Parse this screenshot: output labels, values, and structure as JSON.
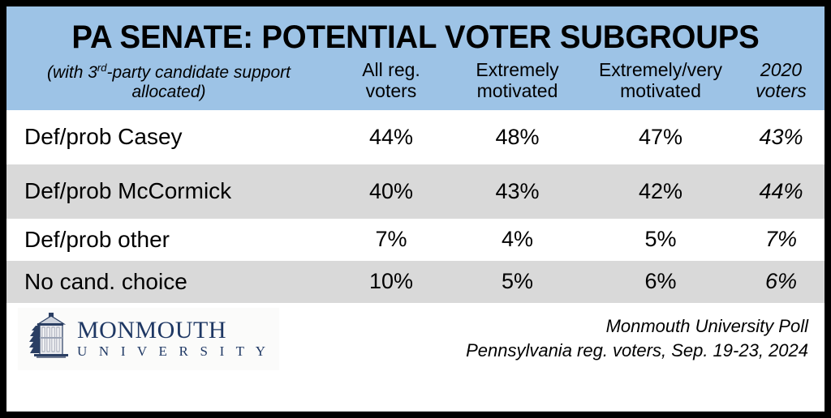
{
  "title": "PA SENATE: POTENTIAL VOTER SUBGROUPS",
  "subtitle": {
    "before": "(with 3",
    "superscript": "rd",
    "after": "-party candidate support allocated)",
    "full": "(with 3rd-party candidate support allocated)"
  },
  "columns": [
    {
      "id": "all_reg_voters",
      "line1": "All reg.",
      "line2": "voters",
      "italic": false
    },
    {
      "id": "extremely_motivated",
      "line1": "Extremely",
      "line2": "motivated",
      "italic": false
    },
    {
      "id": "extremely_very_motivated",
      "line1": "Extremely/very",
      "line2": "motivated",
      "italic": false
    },
    {
      "id": "voters_2020",
      "line1": "2020",
      "line2": "voters",
      "italic": true
    }
  ],
  "rows": [
    {
      "label": "Def/prob Casey",
      "values": [
        "44%",
        "48%",
        "47%",
        "43%"
      ],
      "shaded": false
    },
    {
      "label": "Def/prob McCormick",
      "values": [
        "40%",
        "43%",
        "42%",
        "44%"
      ],
      "shaded": true
    },
    {
      "label": "Def/prob other",
      "values": [
        "7%",
        "4%",
        "5%",
        "7%"
      ],
      "shaded": false
    },
    {
      "label": "No cand. choice",
      "values": [
        "10%",
        "5%",
        "6%",
        "6%"
      ],
      "shaded": true
    }
  ],
  "logo": {
    "name": "MONMOUTH",
    "sub": "U N I V E R S I T Y",
    "icon": "monmouth-wilson-hall-icon"
  },
  "credit": {
    "line1": "Monmouth University Poll",
    "line2": "Pennsylvania reg. voters, Sep. 19-23, 2024"
  },
  "colors": {
    "header_band": "#9dc3e6",
    "row_shaded": "#d9d9d9",
    "row_plain": "#ffffff",
    "border": "#000000",
    "logo_navy": "#1f3864",
    "text": "#000000"
  }
}
